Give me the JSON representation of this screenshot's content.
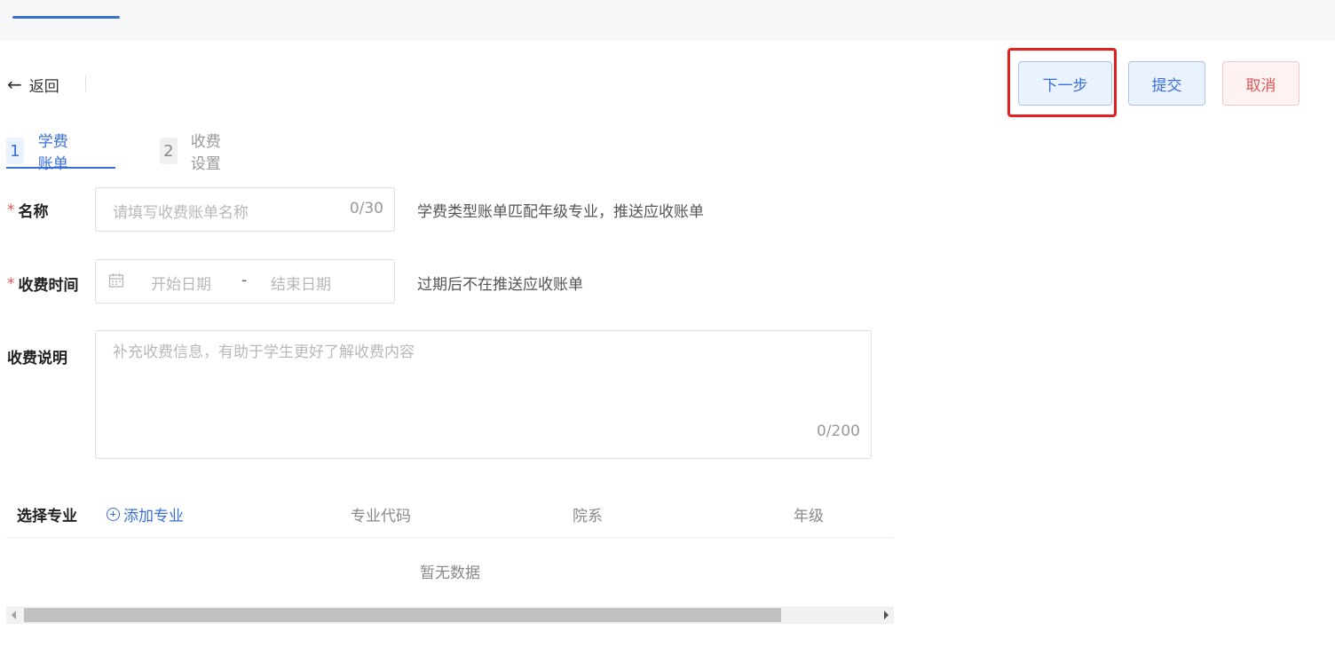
{
  "header": {
    "back_label": "返回",
    "back_icon": "arrow-left-icon"
  },
  "actions": {
    "next_label": "下一步",
    "submit_label": "提交",
    "cancel_label": "取消"
  },
  "steps": [
    {
      "num": "1",
      "label": "学费账单",
      "active": true
    },
    {
      "num": "2",
      "label": "收费设置",
      "active": false
    }
  ],
  "form": {
    "name": {
      "required_mark": "*",
      "label": "名称",
      "placeholder": "请填写收费账单名称",
      "counter": "0/30",
      "hint": "学费类型账单匹配年级专业，推送应收账单"
    },
    "time": {
      "required_mark": "*",
      "label": "收费时间",
      "start_placeholder": "开始日期",
      "separator": "-",
      "end_placeholder": "结束日期",
      "hint": "过期后不在推送应收账单",
      "icon": "calendar-icon"
    },
    "description": {
      "label": "收费说明",
      "placeholder": "补充收费信息，有助于学生更好了解收费内容",
      "counter": "0/200"
    }
  },
  "majors_table": {
    "select_label": "选择专业",
    "add_label": "添加专业",
    "add_icon": "plus-circle-icon",
    "columns": [
      "专业代码",
      "院系",
      "年级"
    ],
    "empty_text": "暂无数据"
  },
  "colors": {
    "primary": "#3a6fd8",
    "danger": "#e05555",
    "highlight": "#e61e1e"
  }
}
